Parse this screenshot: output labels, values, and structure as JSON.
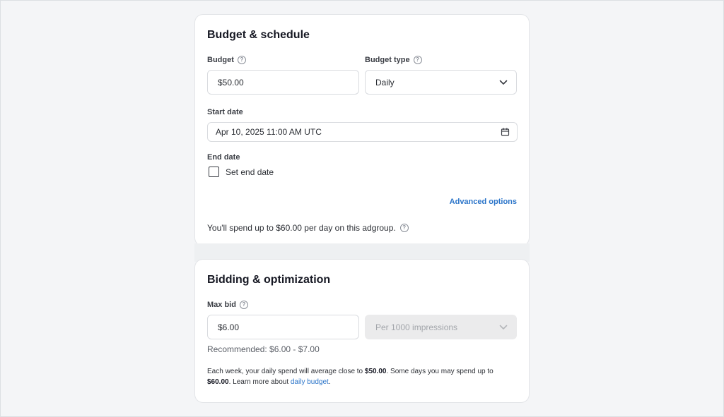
{
  "budget_schedule": {
    "title": "Budget & schedule",
    "budget_label": "Budget",
    "budget_value": "$50.00",
    "budget_type_label": "Budget type",
    "budget_type_value": "Daily",
    "start_date_label": "Start date",
    "start_date_value": "Apr 10, 2025 11:00 AM UTC",
    "end_date_label": "End date",
    "set_end_date_label": "Set end date",
    "set_end_date_checked": false,
    "advanced_options": "Advanced options",
    "spend_note": "You'll spend up to $60.00 per day on this adgroup."
  },
  "bidding": {
    "title": "Bidding & optimization",
    "max_bid_label": "Max bid",
    "max_bid_value": "$6.00",
    "per_unit_value": "Per 1000 impressions",
    "recommended": "Recommended: $6.00 - $7.00",
    "weekly_part1": "Each week, your daily spend will average close to ",
    "weekly_amount1": "$50.00",
    "weekly_part2": ". Some days you may spend up to ",
    "weekly_amount2": "$60.00",
    "weekly_part3": ". Learn more about ",
    "weekly_link": "daily budget",
    "weekly_part4": "."
  },
  "icons": {
    "help": "question-circle-icon",
    "dropdown": "chevron-down-icon",
    "calendar": "calendar-icon"
  },
  "colors": {
    "link": "#2a74c9",
    "disabled_bg": "#ebebec"
  }
}
